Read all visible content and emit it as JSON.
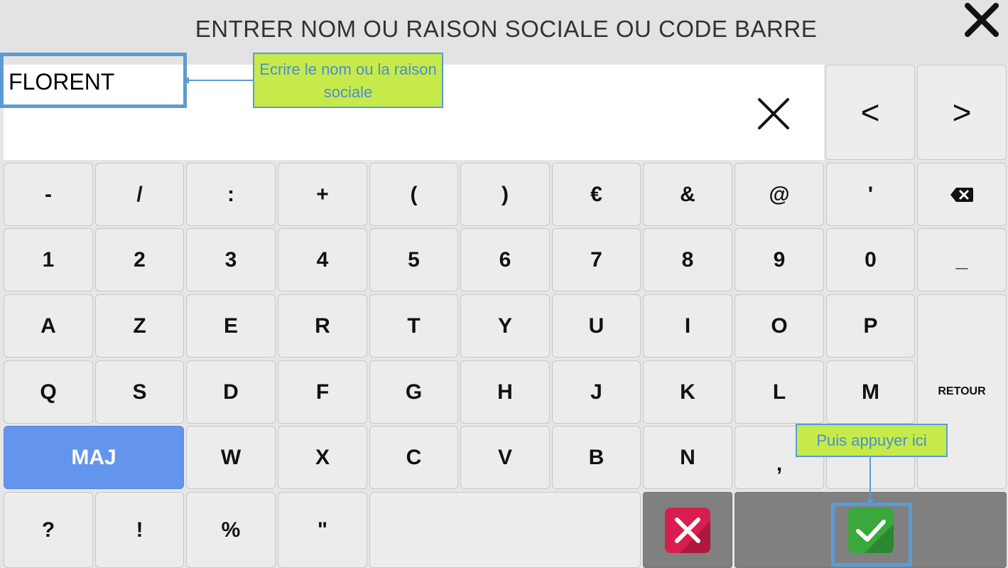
{
  "header": {
    "title": "ENTRER NOM OU RAISON SOCIALE OU CODE BARRE"
  },
  "input": {
    "value": "FLORENT"
  },
  "keys": {
    "row0": [
      "-",
      "/",
      ":",
      "+",
      "(",
      ")",
      "€",
      "&",
      "@",
      "'"
    ],
    "row1": [
      "1",
      "2",
      "3",
      "4",
      "5",
      "6",
      "7",
      "8",
      "9",
      "0",
      "_"
    ],
    "row2": [
      "A",
      "Z",
      "E",
      "R",
      "T",
      "Y",
      "U",
      "I",
      "O",
      "P"
    ],
    "row3": [
      "Q",
      "S",
      "D",
      "F",
      "G",
      "H",
      "J",
      "K",
      "L",
      "M"
    ],
    "row4": [
      "W",
      "X",
      "C",
      "V",
      "B",
      "N",
      ","
    ],
    "row5": [
      "?",
      "!",
      "%",
      "\""
    ],
    "maj": "MAJ",
    "retour": "RETOUR",
    "prev": "<",
    "next": ">"
  },
  "annotations": {
    "name_hint": "Ecrire le nom ou la raison sociale",
    "validate_hint": "Puis appuyer ici"
  },
  "colors": {
    "maj": "#6495ed",
    "cancel": "#d81e4e",
    "validate": "#3aa83a",
    "annotation_bg": "#c6ea4a",
    "annotation_border": "#5b9bd5"
  },
  "icons": {
    "close": "close-icon",
    "clear": "clear-input-icon",
    "backspace": "backspace-icon",
    "cancel": "cancel-icon",
    "validate": "checkmark-icon"
  }
}
